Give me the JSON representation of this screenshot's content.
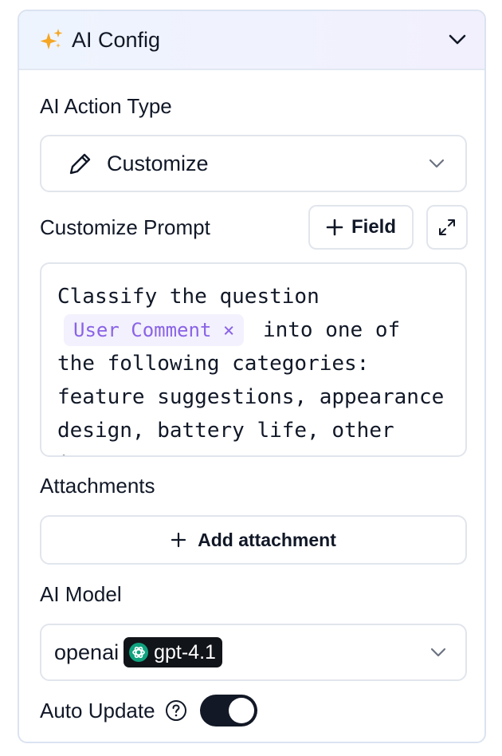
{
  "header": {
    "title": "AI Config",
    "icon": "sparkle-icon"
  },
  "action_type": {
    "label": "AI Action Type",
    "value": "Customize",
    "icon": "pencil-icon"
  },
  "prompt": {
    "label": "Customize Prompt",
    "field_button": "Field",
    "text_before": "Classify the question",
    "chip": "User Comment",
    "text_after": " into one of the following categories: feature suggestions, appearance design, battery life, other issues, etc."
  },
  "attachments": {
    "label": "Attachments",
    "add_button": "Add attachment"
  },
  "model": {
    "label": "AI Model",
    "provider": "openai",
    "name": "gpt-4.1"
  },
  "auto_update": {
    "label": "Auto Update",
    "enabled": true
  },
  "colors": {
    "accent_chip": "#8a63e6",
    "toggle_on": "#121826",
    "sparkle": "#f5a623"
  }
}
